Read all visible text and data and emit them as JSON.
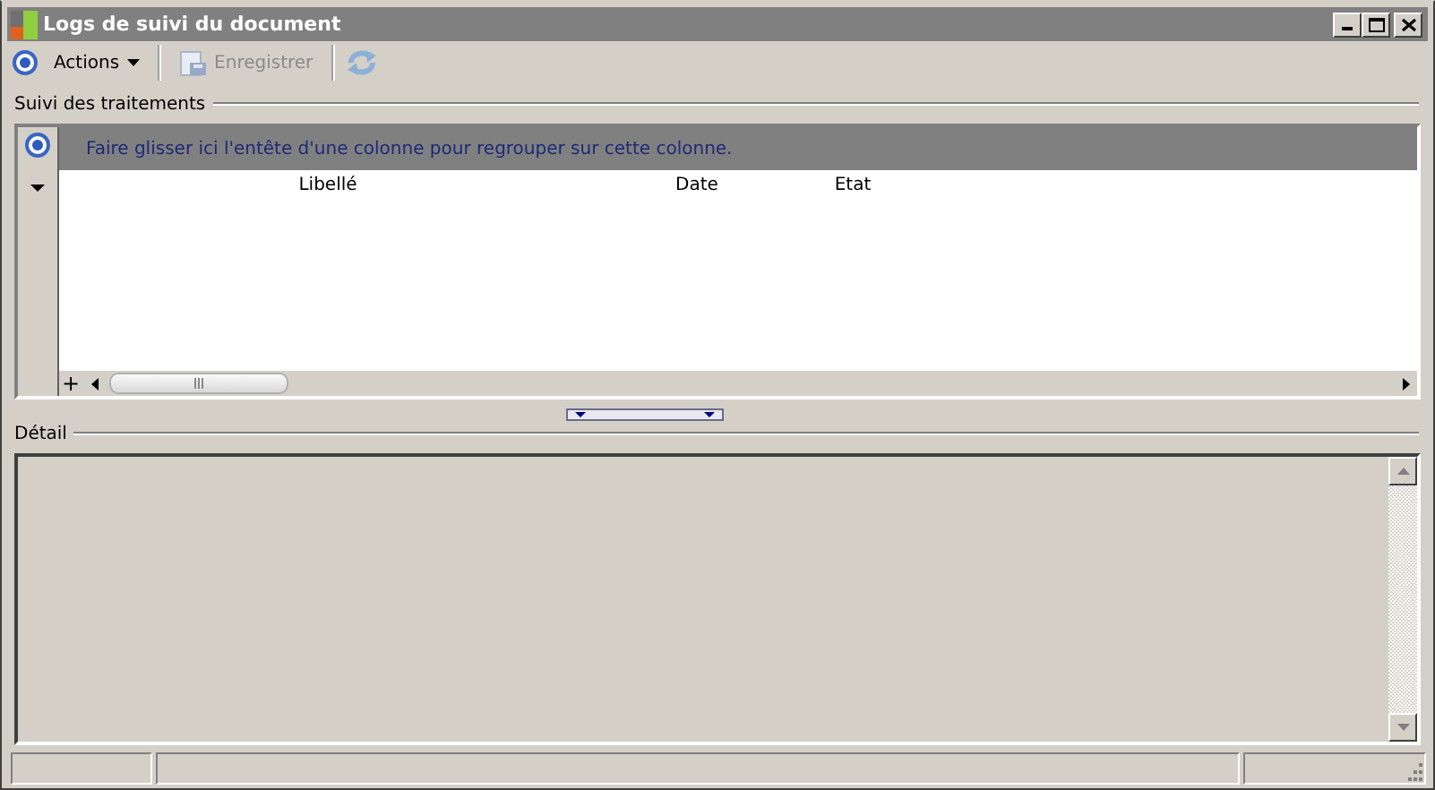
{
  "window": {
    "title": "Logs de suivi du document"
  },
  "toolbar": [
    {
      "kind": "menu",
      "label": "Actions",
      "disabled": false
    },
    {
      "kind": "save",
      "label": "Enregistrer",
      "disabled": true
    },
    {
      "kind": "refresh",
      "disabled": true
    }
  ],
  "treatments": {
    "title": "Suivi des traitements",
    "group_hint": "Faire glisser ici l'entête d'une colonne pour regrouper sur cette colonne.",
    "columns": [
      "Libellé",
      "Date",
      "Etat"
    ],
    "add_button": "+"
  },
  "detail": {
    "title": "Détail"
  }
}
